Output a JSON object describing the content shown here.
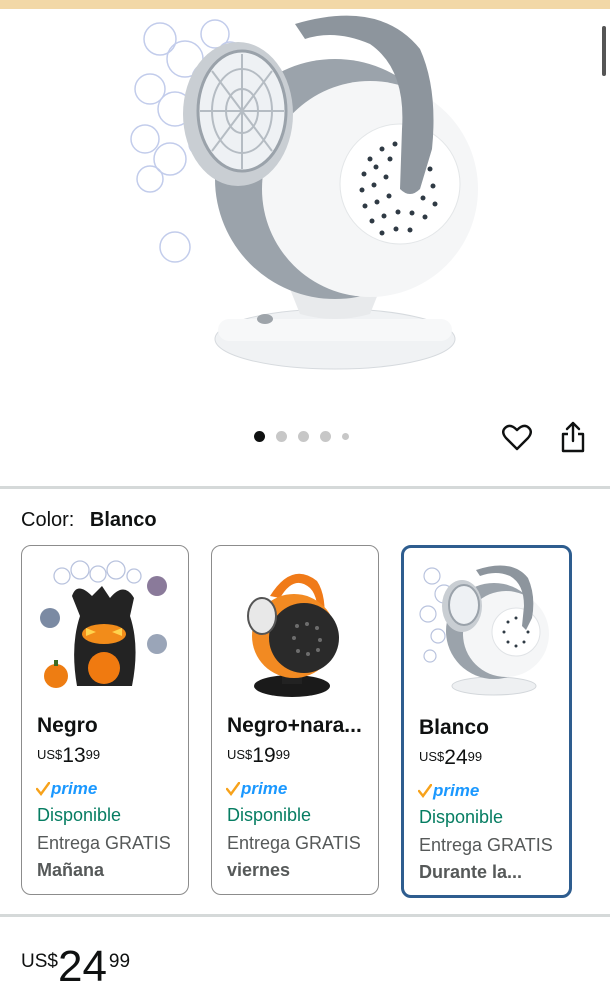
{
  "gallery": {
    "image_count": 5,
    "active_index": 0,
    "image_name": "bubble-machine-white",
    "favorite_icon": "heart-icon",
    "share_icon": "share-icon"
  },
  "color": {
    "label": "Color:",
    "selected": "Blanco"
  },
  "variants": [
    {
      "name": "Negro",
      "currency": "US$",
      "price_whole": "13",
      "price_fraction": "99",
      "prime": "prime",
      "availability": "Disponible",
      "delivery": "Entrega GRATIS",
      "delivery_day": "Mañana",
      "selected": false,
      "thumb": "halloween-tree-bubble-machine"
    },
    {
      "name": "Negro+nara...",
      "currency": "US$",
      "price_whole": "19",
      "price_fraction": "99",
      "prime": "prime",
      "availability": "Disponible",
      "delivery": "Entrega GRATIS",
      "delivery_day": "viernes",
      "selected": false,
      "thumb": "orange-bubble-machine"
    },
    {
      "name": "Blanco",
      "currency": "US$",
      "price_whole": "24",
      "price_fraction": "99",
      "prime": "prime",
      "availability": "Disponible",
      "delivery": "Entrega GRATIS",
      "delivery_day": "Durante la...",
      "selected": true,
      "thumb": "white-bubble-machine"
    }
  ],
  "price": {
    "currency": "US$",
    "whole": "24",
    "fraction": "99"
  },
  "colors": {
    "available_green": "#067d62",
    "prime_blue": "#1a98ff",
    "prime_check_orange": "#f7a21b",
    "selected_border": "#2e5d8f"
  }
}
